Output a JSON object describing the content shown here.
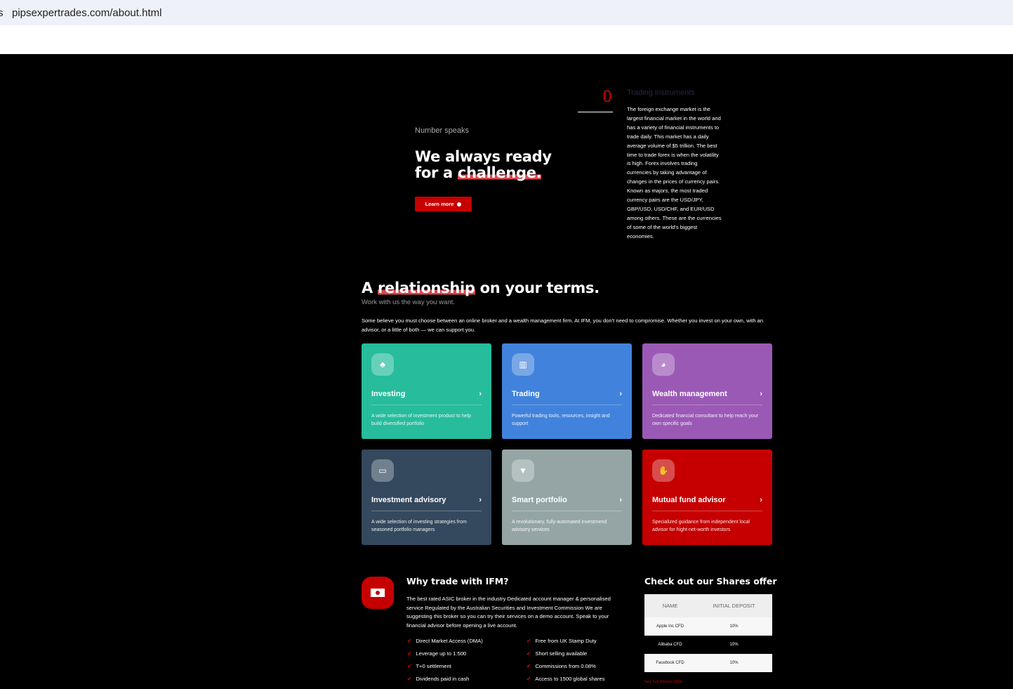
{
  "browser": {
    "url": "pipsexpertrades.com/about.html",
    "left_fragment": "s"
  },
  "counter": {
    "value": "0",
    "title": "Trading instruments",
    "text": "The foreign exchange market is the largest financial market in the world and has a variety of financial instruments to trade daily. This market has a daily average volume of $5 trillion. The best time to trade forex is when the volatility is high. Forex involves trading currencies by taking advantage of changes in the prices of currency pairs. Known as majors, the most traded currency pairs are the USD/JPY, GBP/USD, USD/CHF, and EUR/USD among others. These are the currencies of some of the world's biggest economies."
  },
  "hero": {
    "kicker": "Number speaks",
    "title_a": "We always ready",
    "title_b": "for a ",
    "title_hl": "challenge.",
    "button": "Learn more"
  },
  "relationship": {
    "title_a": "A ",
    "title_hl": "relationship",
    "title_b": " on your terms.",
    "subtitle": "Work with us the way you want.",
    "intro": "Some believe you must choose between an online broker and a wealth management firm. At IFM, you don't need to compromise. Whether you invest on your own, with an advisor, or a little of both — we can support you."
  },
  "cards": [
    {
      "title": "Investing",
      "desc": "A wide selection of investment product to help build diversified portfolio",
      "color": "#26bc9c",
      "icon": "sprout-icon",
      "glyph": "♣"
    },
    {
      "title": "Trading",
      "desc": "Powerful trading tools, resources, insight and support",
      "color": "#4183dc",
      "icon": "chart-icon",
      "glyph": "▥"
    },
    {
      "title": "Wealth management",
      "desc": "Dedicated financial consultant to help reach your own specific goals",
      "color": "#9b59b6",
      "icon": "pie-chart-icon",
      "glyph": "◕"
    },
    {
      "title": "Investment advisory",
      "desc": "A wide selection of investing strategies from seasoned portfolio managers",
      "color": "#34495e",
      "icon": "presentation-icon",
      "glyph": "▭"
    },
    {
      "title": "Smart portfolio",
      "desc": "A revolutionary, fully-automated investmend advisory services",
      "color": "#95a5a6",
      "icon": "funnel-icon",
      "glyph": "▼"
    },
    {
      "title": "Mutual fund advisor",
      "desc": "Specialized guidance from independent local advisor for hight-net-worth investors",
      "color": "#c60000",
      "icon": "handshake-icon",
      "glyph": "✋"
    }
  ],
  "why": {
    "title": "Why trade with IFM?",
    "text": "The best rated ASIC broker in the industry Dedicated account manager & personalised service Regulated by the Australian Securities and Investment Commission We are suggesting this broker so you can try their services on a demo account. Speak to your financial advisor before opening a live account.",
    "features": [
      "Direct Market Access (DMA)",
      "Free from UK Stamp Duty",
      "Leverage up to 1:500",
      "Short selling available",
      "T+0 settlement",
      "Commissions from 0.08%",
      "Dividends paid in cash",
      "Access to 1500 global shares"
    ]
  },
  "shares": {
    "title": "Check out our Shares offer",
    "headers": [
      "NAME",
      "INITIAL DEPOSIT"
    ],
    "rows": [
      [
        "Apple Inc CFD",
        "10%"
      ],
      [
        "Alibaba CFD",
        "10%"
      ],
      [
        "Facebook CFD",
        "10%"
      ]
    ],
    "link": "See Full Shares Table"
  }
}
